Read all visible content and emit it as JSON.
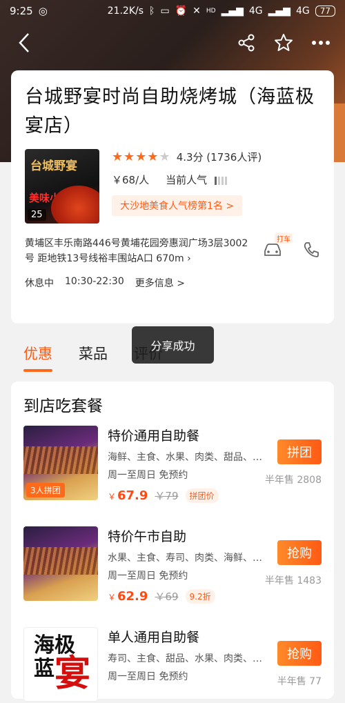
{
  "status_bar": {
    "time": "9:25",
    "net_speed": "21.2K/s",
    "hd": "HD",
    "sig1": "4G",
    "sig2": "4G",
    "battery": "77"
  },
  "shop": {
    "title": "台城野宴时尚自助烧烤城（海蓝极宴店）",
    "image_count": "25",
    "image_logo_text": "台城野宴",
    "image_sub_text": "美味小龙虾",
    "rating_text": "4.3分 (1736人评)",
    "rating_value": 4.3,
    "price": "￥68/人",
    "popularity_label": "当前人气",
    "popularity_level": 0.25,
    "rank_tag": "大沙地美食人气榜第1名 >",
    "address": "黄埔区丰乐南路446号黄埔花园旁惠润广场3层3002号 距地铁13号线裕丰围站A口",
    "distance": "670m",
    "taxi_tag": "打车",
    "status": "休息中",
    "hours": "10:30-22:30",
    "more_info": "更多信息 >"
  },
  "tabs": [
    {
      "label": "优惠",
      "active": true
    },
    {
      "label": "菜品",
      "active": false
    },
    {
      "label": "评价",
      "active": false
    }
  ],
  "toast": "分享成功",
  "deals_section": {
    "title": "到店吃套餐",
    "deals": [
      {
        "name": "特价通用自助餐",
        "desc": "海鲜、主食、水果、肉类、甜品、…",
        "time": "周一至周日 免预约",
        "price": "67.9",
        "currency": "￥",
        "old_price": "￥79",
        "tag": "拼团价",
        "badge": "3人拼团",
        "button": "拼团",
        "sold": "半年售 2808"
      },
      {
        "name": "特价午市自助",
        "desc": "水果、主食、寿司、肉类、海鲜、…",
        "time": "周一至周日 免预约",
        "price": "62.9",
        "currency": "￥",
        "old_price": "￥69",
        "tag": "9.2折",
        "button": "抢购",
        "sold": "半年售 1483"
      },
      {
        "name": "单人通用自助餐",
        "desc": "寿司、主食、甜品、水果、肉类、…",
        "time": "周一至周日 免预约",
        "button": "抢购",
        "sold": "半年售 77",
        "logo_text_a": "海极",
        "logo_text_b": "蓝",
        "logo_text_c": "宴"
      }
    ]
  },
  "colors": {
    "accent": "#ff5a14",
    "button_gradient_start": "#ff8a2a"
  }
}
